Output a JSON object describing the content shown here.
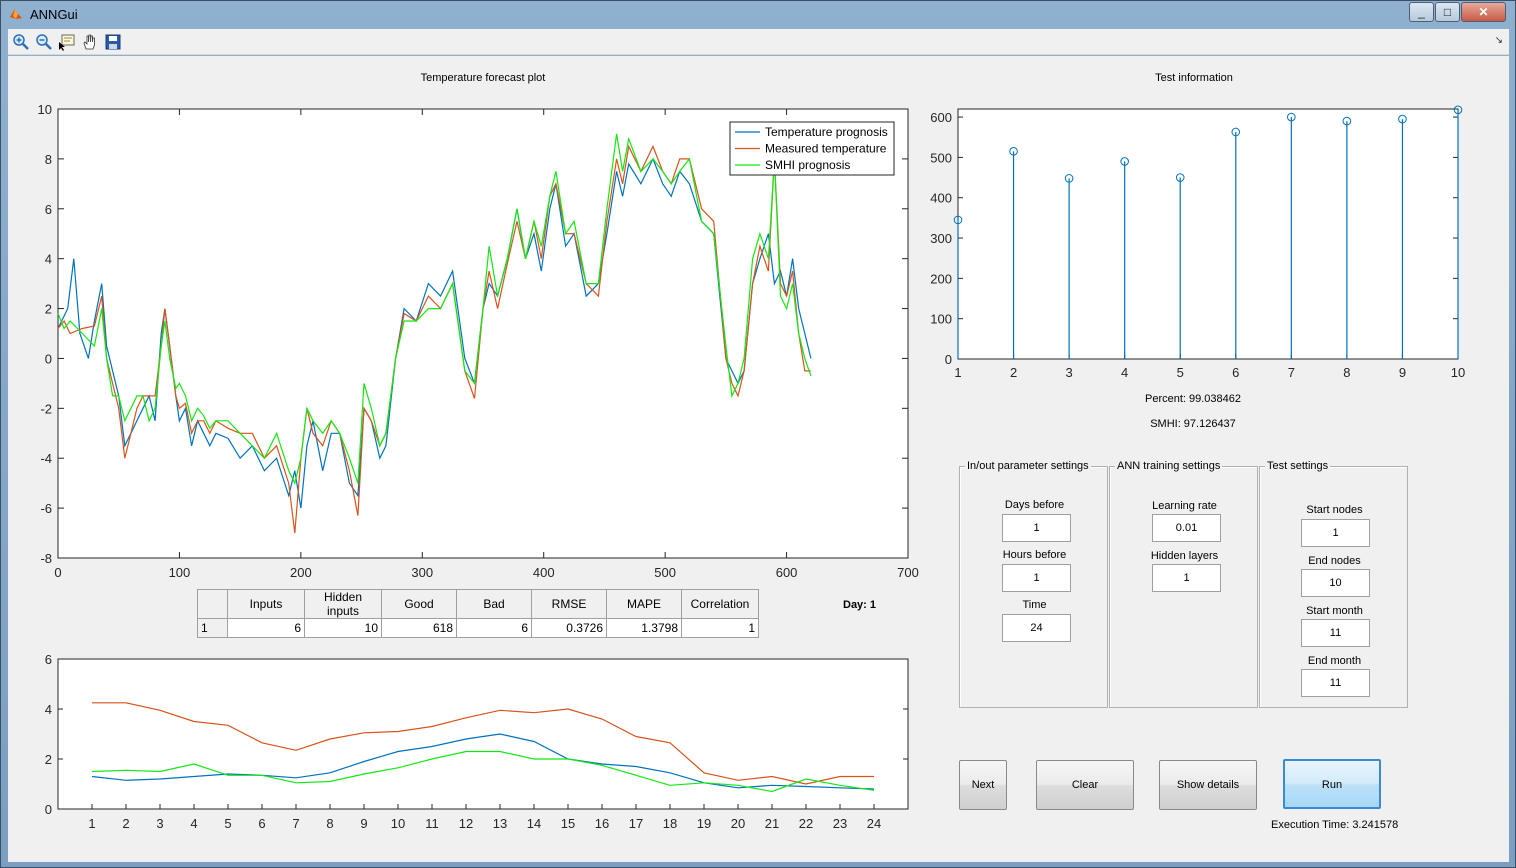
{
  "window": {
    "title": "ANNGui",
    "minimize": "_",
    "maximize": "□",
    "close": "✕"
  },
  "toolbar": {
    "tools": [
      "zoom-in-icon",
      "zoom-out-icon",
      "data-cursor-icon",
      "pan-hand-icon",
      "save-icon"
    ],
    "dock": "↘"
  },
  "forecast_panel": {
    "title": "Temperature forecast plot",
    "legend": [
      "Temperature prognosis",
      "Measured temperature",
      "SMHI prognosis"
    ]
  },
  "test_panel": {
    "title": "Test information",
    "percent": "Percent: 99.038462",
    "smhi": "SMHI: 97.126437"
  },
  "stats_table": {
    "headers": [
      "",
      "Inputs",
      "Hidden inputs",
      "Good",
      "Bad",
      "RMSE",
      "MAPE",
      "Correlation"
    ],
    "rows": [
      [
        "1",
        "6",
        "10",
        "618",
        "6",
        "0.3726",
        "1.3798",
        "1"
      ]
    ]
  },
  "day_label": "Day: 1",
  "inout_settings": {
    "title": "In/out parameter settings",
    "days_before_label": "Days before",
    "days_before": "1",
    "hours_before_label": "Hours before",
    "hours_before": "1",
    "time_label": "Time",
    "time": "24"
  },
  "ann_settings": {
    "title": "ANN training settings",
    "learning_rate_label": "Learning rate",
    "learning_rate": "0.01",
    "hidden_layers_label": "Hidden layers",
    "hidden_layers": "1"
  },
  "test_settings": {
    "title": "Test settings",
    "start_nodes_label": "Start nodes",
    "start_nodes": "1",
    "end_nodes_label": "End nodes",
    "end_nodes": "10",
    "start_month_label": "Start month",
    "start_month": "11",
    "end_month_label": "End month",
    "end_month": "11"
  },
  "buttons": {
    "next": "Next",
    "clear": "Clear",
    "show_details": "Show details",
    "run": "Run"
  },
  "execution_time": "Execution Time: 3.241578",
  "colors": {
    "blue": "#0072bd",
    "orange": "#d95319",
    "green": "#14e814"
  },
  "chart_data": [
    {
      "type": "line",
      "xlim": [
        0,
        700
      ],
      "ylim": [
        -8,
        10
      ],
      "xticks": [
        0,
        100,
        200,
        300,
        400,
        500,
        600,
        700
      ],
      "yticks": [
        -8,
        -6,
        -4,
        -2,
        0,
        2,
        4,
        6,
        8,
        10
      ],
      "legend_position": "top-right",
      "series": [
        {
          "name": "Temperature prognosis",
          "color": "#0072bd",
          "x": [
            0,
            8,
            13,
            18,
            25,
            30,
            36,
            40,
            45,
            50,
            55,
            60,
            65,
            70,
            75,
            80,
            85,
            88,
            92,
            97,
            100,
            105,
            110,
            115,
            120,
            125,
            130,
            140,
            150,
            160,
            170,
            180,
            190,
            195,
            200,
            205,
            210,
            218,
            225,
            232,
            240,
            247,
            252,
            258,
            265,
            270,
            278,
            285,
            295,
            305,
            315,
            325,
            335,
            343,
            350,
            355,
            362,
            370,
            378,
            385,
            392,
            398,
            405,
            410,
            418,
            425,
            435,
            445,
            452,
            460,
            465,
            470,
            480,
            490,
            498,
            505,
            512,
            520,
            530,
            540,
            550,
            555,
            560,
            565,
            572,
            578,
            585,
            590,
            595,
            600,
            605,
            610,
            615,
            620
          ],
          "values": [
            1.2,
            2.0,
            4.0,
            1.0,
            0.0,
            1.5,
            3.0,
            0.5,
            -0.5,
            -1.5,
            -3.5,
            -3.0,
            -2.5,
            -2.0,
            -1.5,
            -2.5,
            1.0,
            2.0,
            0.5,
            -1.5,
            -2.5,
            -2.0,
            -3.5,
            -2.5,
            -3.0,
            -3.5,
            -3.0,
            -3.2,
            -4.0,
            -3.5,
            -4.5,
            -4.0,
            -5.5,
            -4.5,
            -6.0,
            -3.5,
            -2.5,
            -4.5,
            -3.0,
            -3.0,
            -5.0,
            -5.5,
            -2.0,
            -2.5,
            -4.0,
            -3.5,
            0.0,
            2.0,
            1.5,
            3.0,
            2.5,
            3.5,
            0.0,
            -1.0,
            2.0,
            3.0,
            2.5,
            4.0,
            6.0,
            4.0,
            5.0,
            3.5,
            6.0,
            7.0,
            4.5,
            5.0,
            2.5,
            3.0,
            5.0,
            7.5,
            6.5,
            7.8,
            7.0,
            8.0,
            7.0,
            6.5,
            7.5,
            7.0,
            5.5,
            5.0,
            0.0,
            -0.5,
            -1.0,
            -0.5,
            3.0,
            4.0,
            5.0,
            3.0,
            3.5,
            2.5,
            4.0,
            2.0,
            1.0,
            0.0
          ]
        },
        {
          "name": "Measured temperature",
          "color": "#d95319",
          "x": [
            0,
            5,
            10,
            20,
            30,
            36,
            40,
            45,
            50,
            55,
            60,
            65,
            70,
            75,
            80,
            85,
            88,
            92,
            97,
            100,
            105,
            110,
            115,
            120,
            125,
            130,
            140,
            150,
            160,
            170,
            180,
            190,
            195,
            200,
            205,
            210,
            218,
            225,
            232,
            240,
            247,
            252,
            258,
            265,
            270,
            278,
            285,
            295,
            305,
            315,
            325,
            335,
            343,
            350,
            355,
            362,
            370,
            378,
            385,
            392,
            398,
            405,
            410,
            418,
            425,
            435,
            445,
            452,
            460,
            465,
            470,
            480,
            490,
            498,
            505,
            512,
            520,
            530,
            540,
            550,
            555,
            560,
            565,
            572,
            578,
            585,
            590,
            595,
            600,
            605,
            610,
            615,
            620
          ],
          "values": [
            1.2,
            1.5,
            1.0,
            1.2,
            1.3,
            2.5,
            0.0,
            -1.0,
            -2.0,
            -4.0,
            -3.0,
            -2.0,
            -1.5,
            -1.5,
            -1.5,
            0.5,
            2.0,
            0.5,
            -1.5,
            -2.0,
            -1.8,
            -3.0,
            -2.5,
            -2.5,
            -3.0,
            -2.5,
            -2.8,
            -3.0,
            -3.0,
            -4.0,
            -3.5,
            -5.0,
            -7.0,
            -4.0,
            -2.0,
            -3.0,
            -3.5,
            -2.5,
            -3.0,
            -4.5,
            -6.3,
            -2.0,
            -2.5,
            -3.5,
            -3.0,
            0.0,
            1.8,
            1.5,
            2.5,
            2.0,
            3.0,
            -0.5,
            -1.6,
            2.0,
            3.5,
            2.0,
            3.8,
            5.5,
            4.0,
            5.5,
            4.0,
            6.5,
            7.0,
            5.0,
            5.0,
            3.0,
            2.5,
            5.5,
            8.0,
            7.0,
            8.5,
            7.5,
            8.5,
            7.5,
            7.0,
            8.0,
            8.0,
            6.0,
            5.5,
            0.0,
            -1.0,
            -1.5,
            -0.5,
            3.0,
            4.5,
            3.5,
            8.0,
            3.0,
            2.5,
            3.5,
            1.0,
            -0.5,
            -0.5
          ]
        },
        {
          "name": "SMHI prognosis",
          "color": "#14e814",
          "x": [
            0,
            5,
            10,
            20,
            30,
            36,
            40,
            45,
            50,
            55,
            60,
            65,
            70,
            75,
            80,
            85,
            88,
            92,
            97,
            100,
            105,
            110,
            115,
            120,
            125,
            130,
            140,
            150,
            160,
            170,
            180,
            190,
            195,
            200,
            205,
            210,
            218,
            225,
            232,
            240,
            247,
            252,
            258,
            265,
            270,
            278,
            285,
            295,
            305,
            315,
            325,
            335,
            343,
            350,
            355,
            362,
            370,
            378,
            385,
            392,
            398,
            405,
            410,
            418,
            425,
            435,
            445,
            452,
            460,
            465,
            470,
            480,
            490,
            498,
            505,
            512,
            520,
            530,
            540,
            550,
            555,
            560,
            565,
            572,
            578,
            585,
            590,
            595,
            600,
            605,
            610,
            615,
            620
          ],
          "values": [
            1.8,
            1.2,
            1.5,
            1.0,
            0.5,
            2.0,
            0.0,
            -1.5,
            -1.5,
            -2.5,
            -2.0,
            -1.5,
            -1.5,
            -2.5,
            -2.0,
            0.5,
            1.5,
            0.0,
            -1.2,
            -1.0,
            -1.5,
            -2.5,
            -2.0,
            -2.3,
            -2.8,
            -2.5,
            -2.5,
            -3.0,
            -3.5,
            -4.0,
            -3.0,
            -4.5,
            -5.0,
            -4.0,
            -2.0,
            -2.5,
            -3.0,
            -2.5,
            -3.0,
            -4.0,
            -5.0,
            -1.0,
            -2.0,
            -3.5,
            -3.0,
            0.0,
            1.5,
            1.5,
            2.0,
            2.0,
            3.0,
            -0.5,
            -1.0,
            2.0,
            4.5,
            2.5,
            4.0,
            6.0,
            4.0,
            5.5,
            4.5,
            6.5,
            7.5,
            5.0,
            5.5,
            3.0,
            3.0,
            6.0,
            9.0,
            7.5,
            8.8,
            7.5,
            8.0,
            7.5,
            7.0,
            7.5,
            8.0,
            5.5,
            5.0,
            0.5,
            -1.5,
            -1.0,
            0.0,
            4.0,
            5.0,
            4.0,
            8.0,
            2.5,
            2.0,
            3.0,
            1.0,
            0.0,
            -0.7
          ]
        }
      ]
    },
    {
      "type": "scatter",
      "subtype": "stem",
      "x": [
        1,
        2,
        3,
        4,
        5,
        6,
        7,
        8,
        9,
        10
      ],
      "values": [
        345,
        515,
        448,
        490,
        450,
        563,
        600,
        590,
        595,
        618
      ],
      "xlim": [
        1,
        10
      ],
      "ylim": [
        0,
        620
      ],
      "yticks": [
        0,
        100,
        200,
        300,
        400,
        500,
        600
      ],
      "color": "#0072bd"
    },
    {
      "type": "line",
      "categories": [
        1,
        2,
        3,
        4,
        5,
        6,
        7,
        8,
        9,
        10,
        11,
        12,
        13,
        14,
        15,
        16,
        17,
        18,
        19,
        20,
        21,
        22,
        23,
        24
      ],
      "xlim": [
        0,
        25
      ],
      "ylim": [
        0,
        6
      ],
      "yticks": [
        0,
        2,
        4,
        6
      ],
      "series": [
        {
          "color": "#d95319",
          "values": [
            4.25,
            4.25,
            3.95,
            3.5,
            3.35,
            2.65,
            2.35,
            2.8,
            3.05,
            3.1,
            3.3,
            3.65,
            3.95,
            3.85,
            4.0,
            3.6,
            2.9,
            2.65,
            1.45,
            1.15,
            1.3,
            1.0,
            1.3,
            1.3
          ]
        },
        {
          "color": "#0072bd",
          "values": [
            1.3,
            1.15,
            1.2,
            1.3,
            1.4,
            1.35,
            1.25,
            1.45,
            1.9,
            2.3,
            2.5,
            2.8,
            3.0,
            2.7,
            2.0,
            1.8,
            1.7,
            1.45,
            1.05,
            0.85,
            0.95,
            0.9,
            0.85,
            0.8
          ]
        },
        {
          "color": "#14e814",
          "values": [
            1.5,
            1.55,
            1.5,
            1.8,
            1.35,
            1.35,
            1.05,
            1.1,
            1.4,
            1.65,
            2.0,
            2.3,
            2.3,
            2.0,
            2.0,
            1.75,
            1.35,
            0.95,
            1.05,
            0.95,
            0.7,
            1.2,
            0.95,
            0.75
          ]
        }
      ]
    }
  ]
}
